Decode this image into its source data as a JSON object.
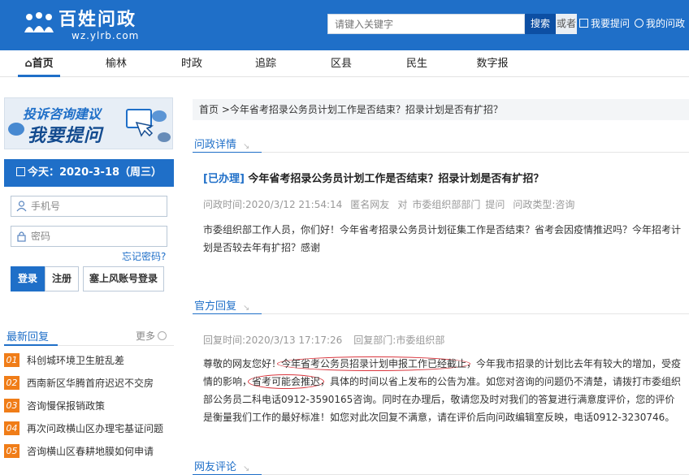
{
  "header": {
    "site_name": "百姓问政",
    "site_url": "wz.ylrb.com",
    "search_placeholder": "请键入关键字",
    "search_button": "搜索",
    "or_label": "或者",
    "ask_link": "我要提问",
    "my_question_link": "我的问政"
  },
  "nav": {
    "items": [
      {
        "label": "首页"
      },
      {
        "label": "榆林"
      },
      {
        "label": "时政"
      },
      {
        "label": "追踪"
      },
      {
        "label": "区县"
      },
      {
        "label": "民生"
      },
      {
        "label": "数字报"
      }
    ]
  },
  "sidebar": {
    "banner_line1": "投诉咨询建议",
    "banner_line2": "我要提问",
    "date_label": "今天：2020-3-18（周三）",
    "phone_placeholder": "手机号",
    "password_placeholder": "密码",
    "forgot_password": "忘记密码?",
    "login_button": "登录",
    "register_button": "注册",
    "third_login_button": "塞上风账号登录",
    "latest_reply_title": "最新回复",
    "more_label": "更多",
    "latest_replies": [
      {
        "num": "01",
        "text": "科创城环境卫生脏乱差"
      },
      {
        "num": "02",
        "text": "西南新区华腾首府迟迟不交房"
      },
      {
        "num": "03",
        "text": "咨询慢保报销政策"
      },
      {
        "num": "04",
        "text": "再次问政横山区办理宅基证问题"
      },
      {
        "num": "05",
        "text": "咨询横山区春耕地膜如何申请"
      }
    ]
  },
  "main": {
    "breadcrumb_home": "首页",
    "breadcrumb_current": " >今年省考招录公务员计划工作是否结束？招录计划是否有扩招？",
    "detail_section": "问政详情",
    "question": {
      "status": "[已办理]",
      "title": "今年省考招录公务员计划工作是否结束？招录计划是否有扩招？",
      "time": "问政时间:2020/3/12 21:54:14",
      "author": "匿名网友",
      "to_label": "对",
      "department": "市委组织部部门",
      "action": "提问",
      "type": "问政类型:咨询",
      "body": "市委组织部工作人员，你们好！今年省考招录公务员计划征集工作是否结束？省考会因疫情推迟吗？今年招考计划是否较去年有扩招？感谢"
    },
    "reply_section": "官方回复",
    "reply": {
      "time": "回复时间:2020/3/13 17:17:26",
      "department": "回复部门:市委组织部",
      "body_part1": "尊敬的网友您好！",
      "highlight1": "今年省考公务员招录计划申报工作已经截止",
      "body_part2": "，今年我市招录的计划比去年有较大的增加，受疫情的影响，",
      "highlight2": "省考可能会推迟",
      "body_part3": "，具体的时间以省上发布的公告为准。如您对咨询的问题仍不清楚，请拨打市委组织部公务员二科电话0912-3590165咨询。同时在办理后，敬请您及时对我们的答复进行满意度评价，您的评价是衡量我们工作的最好标准！如您对此次回复不满意，请在评价后向问政编辑室反映，电话0912-3230746。"
    },
    "comment_section": "网友评论"
  },
  "colors": {
    "brand_blue": "#1f6fc8",
    "dark_blue": "#0d4fa3",
    "badge_orange": "#f07d18",
    "highlight_red": "#d9363e"
  }
}
